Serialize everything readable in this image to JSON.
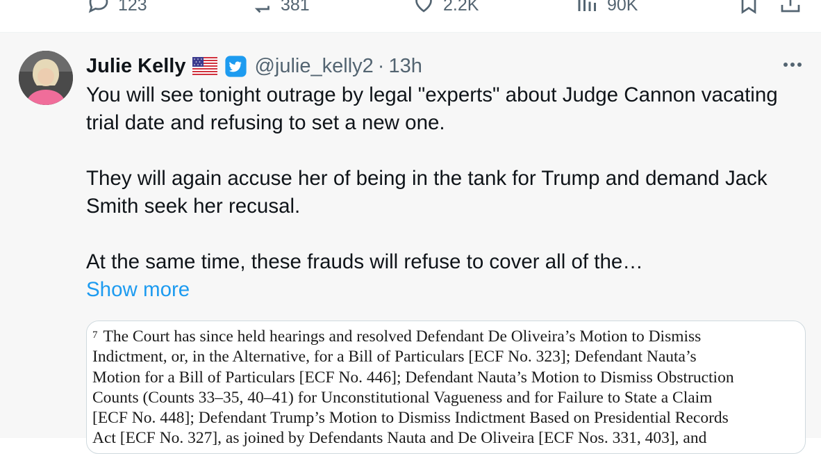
{
  "prev_actions": {
    "replies": "123",
    "reposts": "381",
    "likes": "2.2K",
    "views": "90K"
  },
  "tweet": {
    "display_name": "Julie Kelly",
    "handle": "@julie_kelly2",
    "separator": "·",
    "time": "13h",
    "paragraph1": "You will see tonight outrage by legal \"experts\" about Judge Cannon vacating trial date and refusing to set a new one.",
    "paragraph2": "They will again accuse her of being in the tank for Trump and demand Jack Smith seek her recusal.",
    "paragraph3": "At the same time, these frauds will refuse to cover all of the…",
    "show_more": "Show more"
  },
  "document": {
    "footnote_number": "7",
    "lines": [
      "The Court has since held hearings and resolved Defendant De Oliveira’s Motion to Dismiss",
      "Indictment, or, in the Alternative, for a Bill of Particulars [ECF No. 323]; Defendant Nauta’s",
      "Motion for a Bill of Particulars [ECF No. 446]; Defendant Nauta’s Motion to Dismiss Obstruction",
      "Counts (Counts 33–35, 40–41) for Unconstitutional Vagueness and for Failure to State a Claim",
      "[ECF No. 448]; Defendant Trump’s Motion to Dismiss Indictment Based on Presidential Records",
      "Act [ECF No. 327], as joined by Defendants Nauta and De Oliveira [ECF Nos. 331, 403], and"
    ]
  },
  "colors": {
    "accent": "#1d9bf0",
    "secondary_text": "#536471",
    "card_background": "#f7f7f7"
  },
  "icons": [
    "reply-icon",
    "repost-icon",
    "like-icon",
    "views-icon",
    "bookmark-icon",
    "share-icon",
    "us-flag-icon",
    "verified-badge-icon",
    "more-options-icon"
  ]
}
